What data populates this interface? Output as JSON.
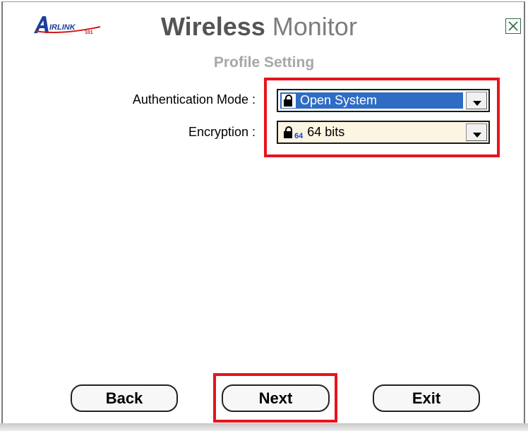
{
  "app": {
    "title_bold": "Wireless",
    "title_light": " Monitor",
    "logo_text": "AIRLINK 101"
  },
  "section_title": "Profile Setting",
  "fields": {
    "auth_label": "Authentication Mode :",
    "auth_value": "Open System",
    "enc_label": "Encryption :",
    "enc_badge": "64",
    "enc_value": "64 bits"
  },
  "buttons": {
    "back": "Back",
    "next": "Next",
    "exit": "Exit"
  },
  "icons": {
    "close": "close-icon",
    "lock": "lock-icon",
    "dropdown": "chevron-down-icon"
  },
  "colors": {
    "highlight": "#e8141b",
    "selected": "#2f6cc4",
    "title": "#545454",
    "section_title": "#a7a7a7"
  }
}
